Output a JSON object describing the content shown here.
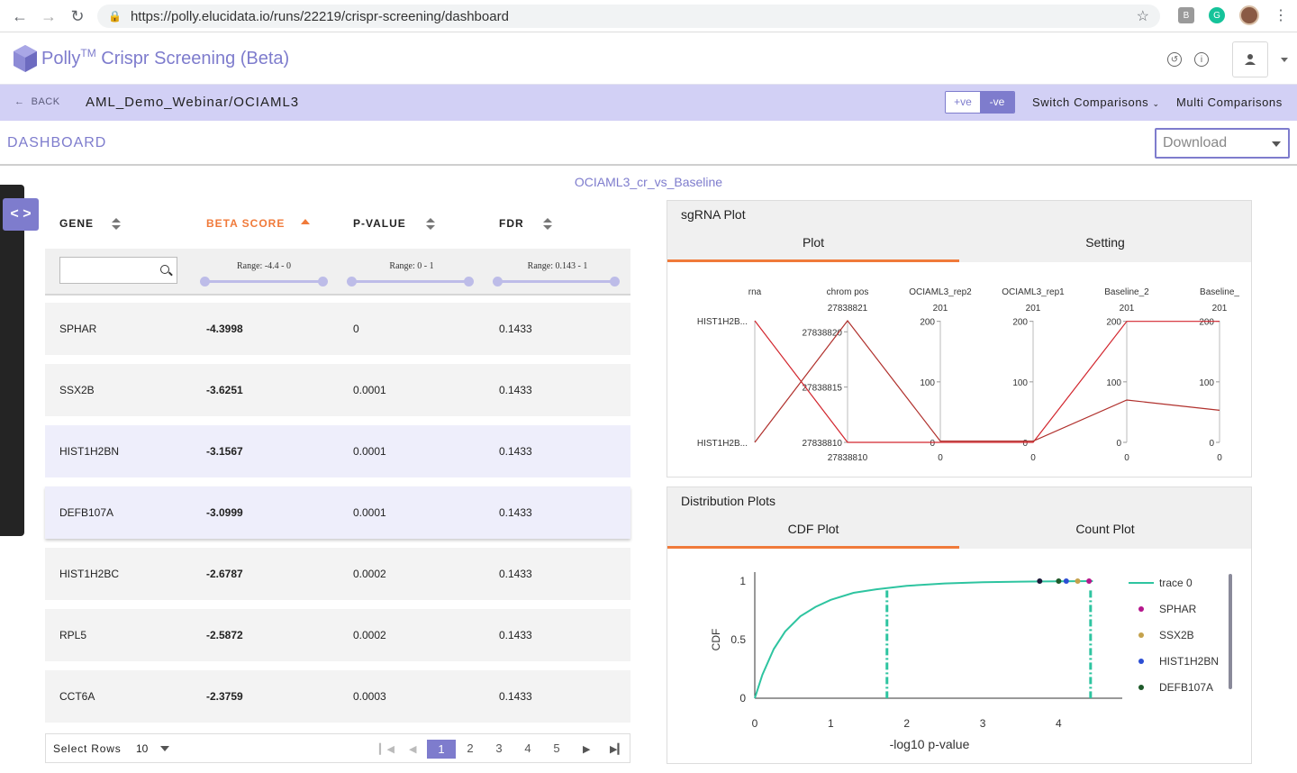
{
  "browser": {
    "url": "https://polly.elucidata.io/runs/22219/crispr-screening/dashboard"
  },
  "app": {
    "name": "Polly",
    "tm": "TM",
    "product": "Crispr Screening (Beta)"
  },
  "subbar": {
    "back": "BACK",
    "breadcrumb": "AML_Demo_Webinar/OCIAML3",
    "pos_label": "+ve",
    "neg_label": "-ve",
    "switch": "Switch Comparisons",
    "multi": "Multi Comparisons"
  },
  "dashboard": {
    "title": "DASHBOARD",
    "download": "Download",
    "comparison": "OCIAML3_cr_vs_Baseline"
  },
  "table": {
    "headers": [
      "GENE",
      "BETA SCORE",
      "P-VALUE",
      "FDR"
    ],
    "ranges": [
      "Range: -4.4 - 0",
      "Range: 0 - 1",
      "Range: 0.143 - 1"
    ],
    "rows": [
      {
        "gene": "SPHAR",
        "beta": "-4.3998",
        "p": "0",
        "fdr": "0.1433"
      },
      {
        "gene": "SSX2B",
        "beta": "-3.6251",
        "p": "0.0001",
        "fdr": "0.1433"
      },
      {
        "gene": "HIST1H2BN",
        "beta": "-3.1567",
        "p": "0.0001",
        "fdr": "0.1433"
      },
      {
        "gene": "DEFB107A",
        "beta": "-3.0999",
        "p": "0.0001",
        "fdr": "0.1433"
      },
      {
        "gene": "HIST1H2BC",
        "beta": "-2.6787",
        "p": "0.0002",
        "fdr": "0.1433"
      },
      {
        "gene": "RPL5",
        "beta": "-2.5872",
        "p": "0.0002",
        "fdr": "0.1433"
      },
      {
        "gene": "CCT6A",
        "beta": "-2.3759",
        "p": "0.0003",
        "fdr": "0.1433"
      }
    ],
    "select_rows": "Select Rows",
    "rows_value": "10",
    "pages": [
      "1",
      "2",
      "3",
      "4",
      "5"
    ],
    "current_page": "1"
  },
  "sgrna": {
    "title": "sgRNA Plot",
    "tabs": [
      "Plot",
      "Setting"
    ],
    "axes": [
      {
        "name": "rna",
        "top": "",
        "bottom": "",
        "ticks": [],
        "cat_top": "HIST1H2B...",
        "cat_bottom": "HIST1H2B..."
      },
      {
        "name": "chrom pos",
        "top": "27838821",
        "bottom": "27838810",
        "ticks": [
          "27838820",
          "27838815",
          "27838810"
        ]
      },
      {
        "name": "OCIAML3_rep2",
        "top": "201",
        "bottom": "0",
        "ticks": [
          "200",
          "100",
          "0"
        ]
      },
      {
        "name": "OCIAML3_rep1",
        "top": "201",
        "bottom": "0",
        "ticks": [
          "200",
          "100",
          "0"
        ]
      },
      {
        "name": "Baseline_2",
        "top": "201",
        "bottom": "0",
        "ticks": [
          "200",
          "100",
          "0"
        ]
      },
      {
        "name": "Baseline_",
        "top": "201",
        "bottom": "0",
        "ticks": [
          "200",
          "100",
          "0"
        ]
      }
    ],
    "lines": [
      {
        "color": "#d2262e",
        "values": [
          "top",
          27838810,
          0,
          0,
          200,
          200
        ]
      },
      {
        "color": "#b0302c",
        "values": [
          "bottom",
          27838821,
          2,
          2,
          70,
          53
        ]
      }
    ]
  },
  "distribution": {
    "title": "Distribution Plots",
    "tabs": [
      "CDF Plot",
      "Count Plot"
    ]
  },
  "chart_data": {
    "type": "line",
    "xlabel": "-log10 p-value",
    "ylabel": "CDF",
    "xlim": [
      0,
      4.6
    ],
    "ylim": [
      0,
      1
    ],
    "x_ticks": [
      "0",
      "1",
      "2",
      "3",
      "4"
    ],
    "y_ticks": [
      "0",
      "0.5",
      "1"
    ],
    "series": [
      {
        "name": "trace 0",
        "color": "#2ec4a0",
        "x": [
          0,
          0.1,
          0.25,
          0.4,
          0.6,
          0.8,
          1.0,
          1.3,
          1.6,
          2.0,
          2.5,
          3.0,
          3.5,
          4.0,
          4.45
        ],
        "y": [
          0,
          0.2,
          0.42,
          0.57,
          0.7,
          0.78,
          0.84,
          0.9,
          0.93,
          0.96,
          0.98,
          0.99,
          0.995,
          0.998,
          1.0
        ]
      }
    ],
    "vlines": [
      {
        "x": 1.74,
        "color": "#2ec4a0"
      },
      {
        "x": 4.42,
        "color": "#2ec4a0"
      }
    ],
    "markers": [
      {
        "name": "SPHAR",
        "x": 4.4,
        "y": 1.0,
        "color": "#b5168c"
      },
      {
        "name": "SSX2B",
        "x": 4.25,
        "y": 1.0,
        "color": "#c4a24c"
      },
      {
        "name": "HIST1H2BN",
        "x": 4.1,
        "y": 1.0,
        "color": "#2c4ed4"
      },
      {
        "name": "DEFB107A",
        "x": 4.0,
        "y": 1.0,
        "color": "#1e5a2a"
      },
      {
        "name": "",
        "x": 3.75,
        "y": 1.0,
        "color": "#1a1a3a"
      }
    ],
    "legend": "right"
  }
}
